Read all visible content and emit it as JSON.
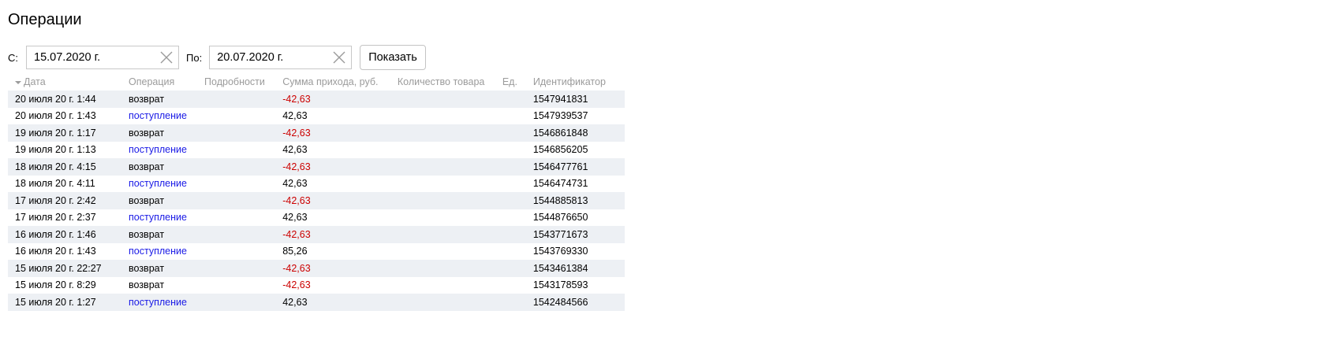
{
  "page": {
    "title": "Операции"
  },
  "filters": {
    "from_label": "С:",
    "from_value": "15.07.2020 г.",
    "to_label": "По:",
    "to_value": "20.07.2020 г.",
    "show_label": "Показать"
  },
  "table": {
    "columns": [
      "Дата",
      "Операция",
      "Подробности",
      "Сумма прихода, руб.",
      "Количество товара",
      "Ед.",
      "Идентификатор"
    ],
    "sort_column": "Дата",
    "rows": [
      {
        "date": "20 июля 20 г. 1:44",
        "operation": "возврат",
        "details": "",
        "amount": "-42,63",
        "quantity": "",
        "unit": "",
        "id": "1547941831"
      },
      {
        "date": "20 июля 20 г. 1:43",
        "operation": "поступление",
        "details": "",
        "amount": "42,63",
        "quantity": "",
        "unit": "",
        "id": "1547939537"
      },
      {
        "date": "19 июля 20 г. 1:17",
        "operation": "возврат",
        "details": "",
        "amount": "-42,63",
        "quantity": "",
        "unit": "",
        "id": "1546861848"
      },
      {
        "date": "19 июля 20 г. 1:13",
        "operation": "поступление",
        "details": "",
        "amount": "42,63",
        "quantity": "",
        "unit": "",
        "id": "1546856205"
      },
      {
        "date": "18 июля 20 г. 4:15",
        "operation": "возврат",
        "details": "",
        "amount": "-42,63",
        "quantity": "",
        "unit": "",
        "id": "1546477761"
      },
      {
        "date": "18 июля 20 г. 4:11",
        "operation": "поступление",
        "details": "",
        "amount": "42,63",
        "quantity": "",
        "unit": "",
        "id": "1546474731"
      },
      {
        "date": "17 июля 20 г. 2:42",
        "operation": "возврат",
        "details": "",
        "amount": "-42,63",
        "quantity": "",
        "unit": "",
        "id": "1544885813"
      },
      {
        "date": "17 июля 20 г. 2:37",
        "operation": "поступление",
        "details": "",
        "amount": "42,63",
        "quantity": "",
        "unit": "",
        "id": "1544876650"
      },
      {
        "date": "16 июля 20 г. 1:46",
        "operation": "возврат",
        "details": "",
        "amount": "-42,63",
        "quantity": "",
        "unit": "",
        "id": "1543771673"
      },
      {
        "date": "16 июля 20 г. 1:43",
        "operation": "поступление",
        "details": "",
        "amount": "85,26",
        "quantity": "",
        "unit": "",
        "id": "1543769330"
      },
      {
        "date": "15 июля 20 г. 22:27",
        "operation": "возврат",
        "details": "",
        "amount": "-42,63",
        "quantity": "",
        "unit": "",
        "id": "1543461384"
      },
      {
        "date": "15 июля 20 г. 8:29",
        "operation": "возврат",
        "details": "",
        "amount": "-42,63",
        "quantity": "",
        "unit": "",
        "id": "1543178593"
      },
      {
        "date": "15 июля 20 г. 1:27",
        "operation": "поступление",
        "details": "",
        "amount": "42,63",
        "quantity": "",
        "unit": "",
        "id": "1542484566"
      }
    ]
  },
  "colors": {
    "link": "#1a1ae6",
    "negative": "#cc0000",
    "row_stripe": "#edf0f4",
    "header_text": "#9b9b9b"
  },
  "icons": {
    "clear": "close-icon",
    "sort": "sort-desc-icon"
  }
}
